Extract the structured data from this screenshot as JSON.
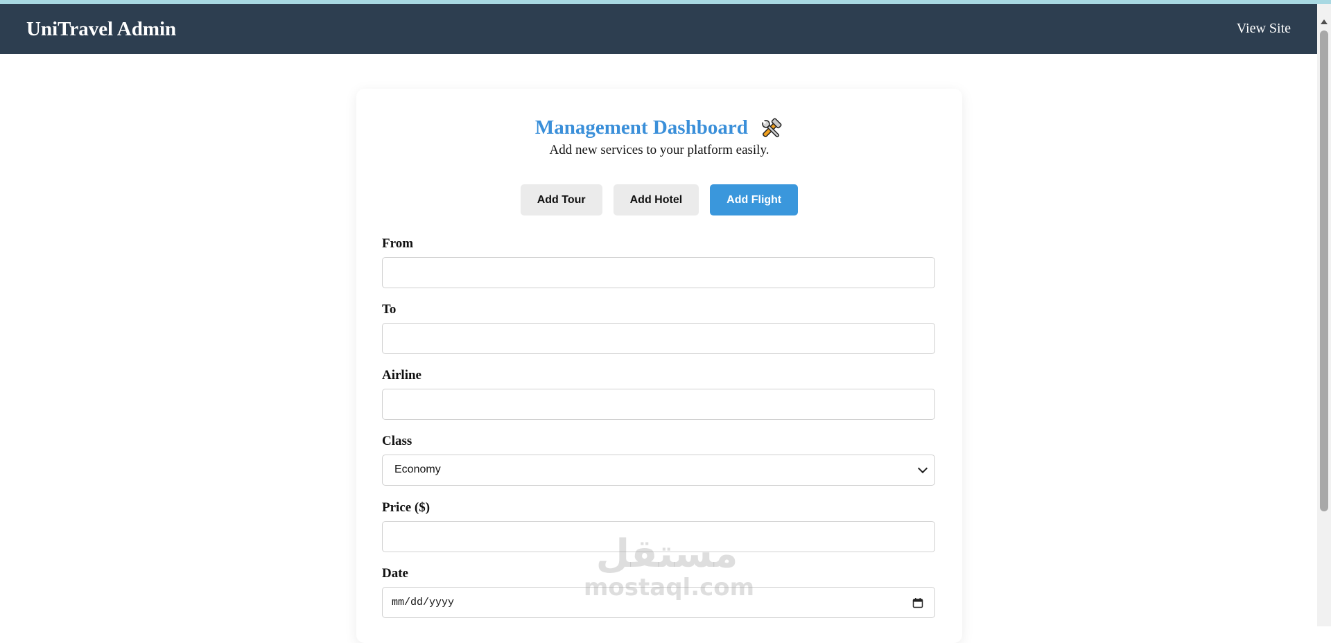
{
  "header": {
    "brand": "UniTravel Admin",
    "view_site": "View Site"
  },
  "dashboard": {
    "title": "Management Dashboard",
    "title_icon": "tools-icon",
    "subtitle": "Add new services to your platform easily."
  },
  "tabs": [
    {
      "label": "Add Tour",
      "active": false
    },
    {
      "label": "Add Hotel",
      "active": false
    },
    {
      "label": "Add Flight",
      "active": true
    }
  ],
  "form": {
    "from_label": "From",
    "from_value": "",
    "to_label": "To",
    "to_value": "",
    "airline_label": "Airline",
    "airline_value": "",
    "class_label": "Class",
    "class_selected": "Economy",
    "price_label": "Price ($)",
    "price_value": "",
    "date_label": "Date",
    "date_placeholder": "mm/dd/yyyy"
  },
  "watermark": {
    "arabic": "مستقل",
    "latin": "mostaql.com"
  },
  "colors": {
    "navbar": "#2d3e50",
    "accent": "#3a8fd9",
    "active_tab": "#3a97dc",
    "inactive_tab": "#ebebeb"
  }
}
